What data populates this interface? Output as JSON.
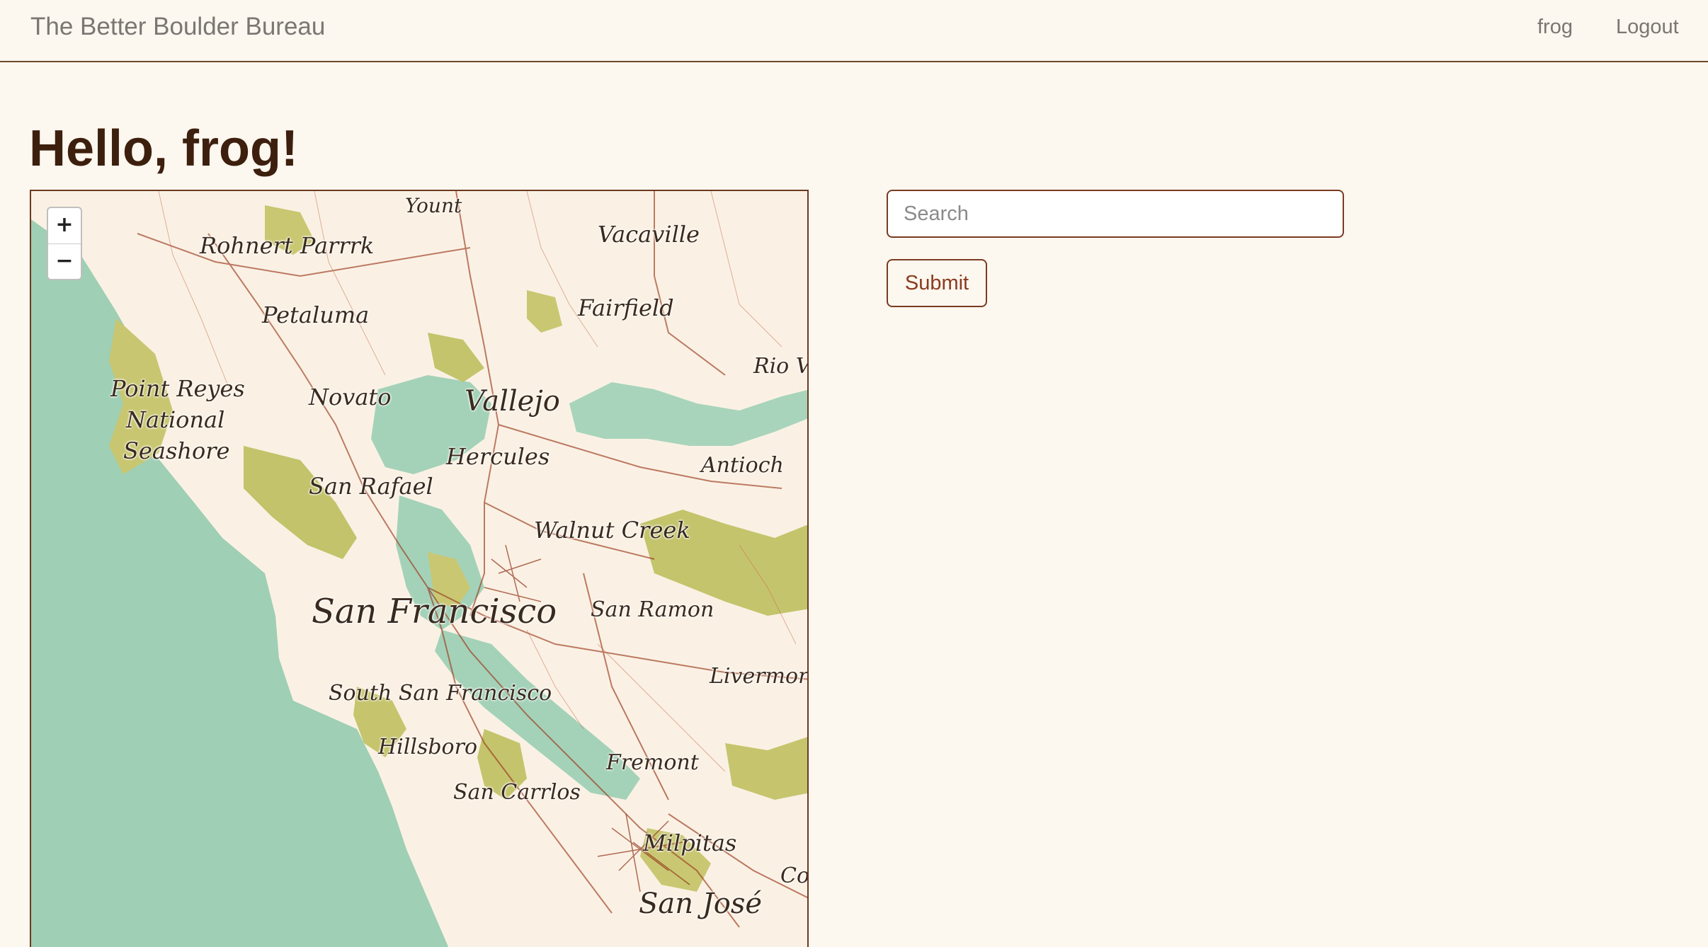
{
  "navbar": {
    "brand": "The Better Boulder Bureau",
    "user_link": "frog",
    "logout_link": "Logout"
  },
  "main": {
    "greeting": "Hello, frog!"
  },
  "map": {
    "zoom_in": "+",
    "zoom_out": "−",
    "labels": {
      "yount": "Yount",
      "vacaville": "Vacaville",
      "rohnert_park": "Rohnert Parrrk",
      "petaluma": "Petaluma",
      "fairfield": "Fairfield",
      "rio_vista": "Rio V",
      "point_reyes": "Point Reyes",
      "national": "National",
      "seashore": "Seashore",
      "novato": "Novato",
      "vallejo": "Vallejo",
      "hercules": "Hercules",
      "antioch": "Antioch",
      "san_rafael": "San Rafael",
      "walnut_creek": "Walnut Creek",
      "san_francisco": "San Francisco",
      "san_ramon": "San Ramon",
      "livermore": "Livermore",
      "south_san_francisco": "South San Francisco",
      "hillsborough": "Hillsboro",
      "fremont": "Fremont",
      "san_carlos": "San Carrlos",
      "milpitas": "Milpitas",
      "co": "Co",
      "san_jose": "San José"
    }
  },
  "search": {
    "placeholder": "Search",
    "value": "",
    "submit_label": "Submit"
  }
}
